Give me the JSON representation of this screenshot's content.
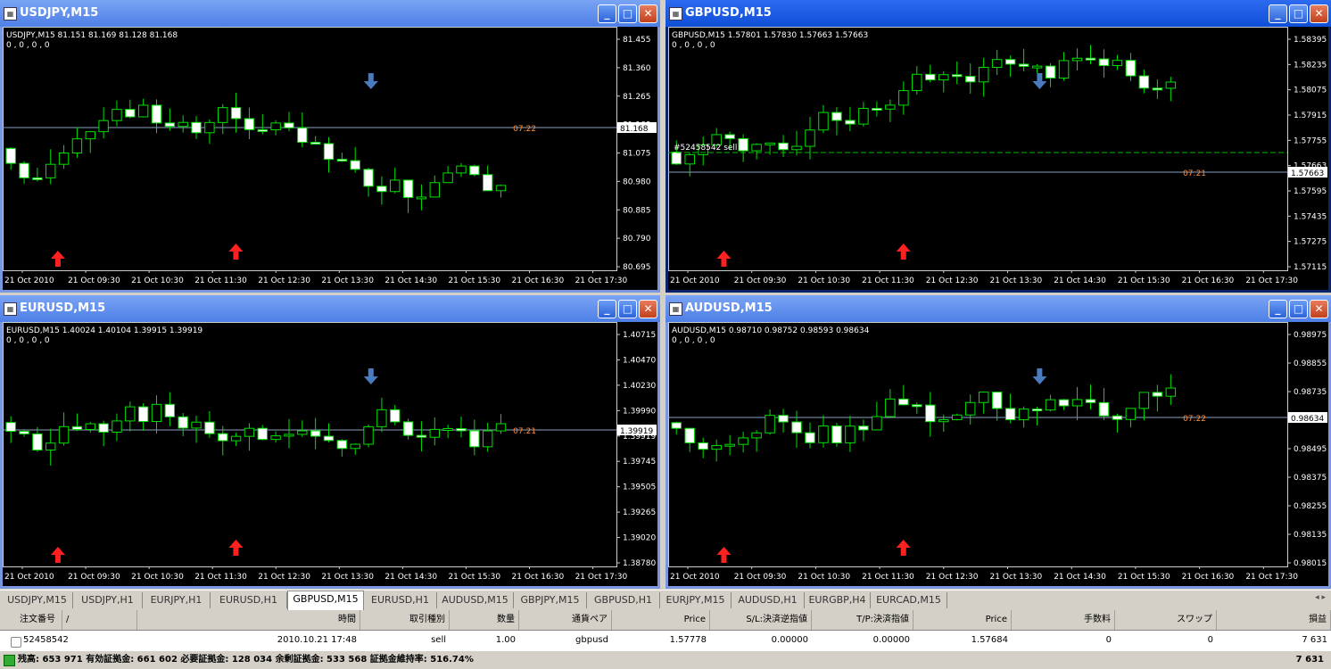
{
  "windows": [
    {
      "title": "USDJPY,M15",
      "active": false,
      "info": "USDJPY,M15  81.151 81.169 81.128 81.168",
      "indicators": "0 , 0 , 0 , 0",
      "price_labels": [
        "81.455",
        "81.360",
        "81.265",
        "81.168",
        "81.075",
        "80.980",
        "80.885",
        "80.790",
        "80.695"
      ],
      "current_price": "81.168",
      "timer": "07:22",
      "time_labels": [
        "21 Oct 2010",
        "21 Oct 09:30",
        "21 Oct 10:30",
        "21 Oct 11:30",
        "21 Oct 12:30",
        "21 Oct 13:30",
        "21 Oct 14:30",
        "21 Oct 15:30",
        "21 Oct 16:30",
        "21 Oct 17:30"
      ]
    },
    {
      "title": "GBPUSD,M15",
      "active": true,
      "info": "GBPUSD,M15  1.57801 1.57830 1.57663 1.57663",
      "indicators": "0 , 0 , 0 , 0",
      "order_label": "#52458542 sell",
      "price_labels": [
        "1.58395",
        "1.58235",
        "1.58075",
        "1.57915",
        "1.57755",
        "1.57663",
        "1.57595",
        "1.57435",
        "1.57275",
        "1.57115"
      ],
      "current_price": "1.57663",
      "timer": "07:21",
      "time_labels": [
        "21 Oct 2010",
        "21 Oct 09:30",
        "21 Oct 10:30",
        "21 Oct 11:30",
        "21 Oct 12:30",
        "21 Oct 13:30",
        "21 Oct 14:30",
        "21 Oct 15:30",
        "21 Oct 16:30",
        "21 Oct 17:30"
      ]
    },
    {
      "title": "EURUSD,M15",
      "active": false,
      "info": "EURUSD,M15  1.40024 1.40104 1.39915 1.39919",
      "indicators": "0 , 0 , 0 , 0",
      "price_labels": [
        "1.40715",
        "1.40470",
        "1.40230",
        "1.39990",
        "1.39919",
        "1.39745",
        "1.39505",
        "1.39265",
        "1.39020",
        "1.38780"
      ],
      "current_price": "1.39919",
      "timer": "07:21",
      "time_labels": [
        "21 Oct 2010",
        "21 Oct 09:30",
        "21 Oct 10:30",
        "21 Oct 11:30",
        "21 Oct 12:30",
        "21 Oct 13:30",
        "21 Oct 14:30",
        "21 Oct 15:30",
        "21 Oct 16:30",
        "21 Oct 17:30"
      ]
    },
    {
      "title": "AUDUSD,M15",
      "active": false,
      "info": "AUDUSD,M15  0.98710 0.98752 0.98593 0.98634",
      "indicators": "0 , 0 , 0 , 0",
      "price_labels": [
        "0.98975",
        "0.98855",
        "0.98735",
        "0.98634",
        "0.98495",
        "0.98375",
        "0.98255",
        "0.98135",
        "0.98015"
      ],
      "current_price": "0.98634",
      "timer": "07:22",
      "time_labels": [
        "21 Oct 2010",
        "21 Oct 09:30",
        "21 Oct 10:30",
        "21 Oct 11:30",
        "21 Oct 12:30",
        "21 Oct 13:30",
        "21 Oct 14:30",
        "21 Oct 15:30",
        "21 Oct 16:30",
        "21 Oct 17:30"
      ]
    }
  ],
  "tabs": [
    "USDJPY,M15",
    "USDJPY,H1",
    "EURJPY,H1",
    "EURUSD,H1",
    "GBPUSD,M15",
    "EURUSD,H1",
    "AUDUSD,M15",
    "GBPJPY,M15",
    "GBPUSD,H1",
    "EURJPY,M15",
    "AUDUSD,H1",
    "EURGBP,H4",
    "EURCAD,M15"
  ],
  "selected_tab": "GBPUSD,M15",
  "table": {
    "headers": [
      "注文番号",
      "/",
      "時間",
      "取引種別",
      "数量",
      "通貨ペア",
      "Price",
      "S/L:決済逆指値",
      "T/P:決済指値",
      "Price",
      "手数料",
      "スワップ",
      "損益"
    ],
    "row": [
      "52458542",
      "2010.10.21 17:48",
      "sell",
      "1.00",
      "gbpusd",
      "1.57778",
      "0.00000",
      "0.00000",
      "1.57684",
      "0",
      "0",
      "7 631"
    ],
    "summary": "残高: 653 971  有効証拠金: 661 602  必要証拠金: 128 034  余剰証拠金: 533 568  証拠金維持率: 516.74%",
    "summary_total": "7 631"
  }
}
